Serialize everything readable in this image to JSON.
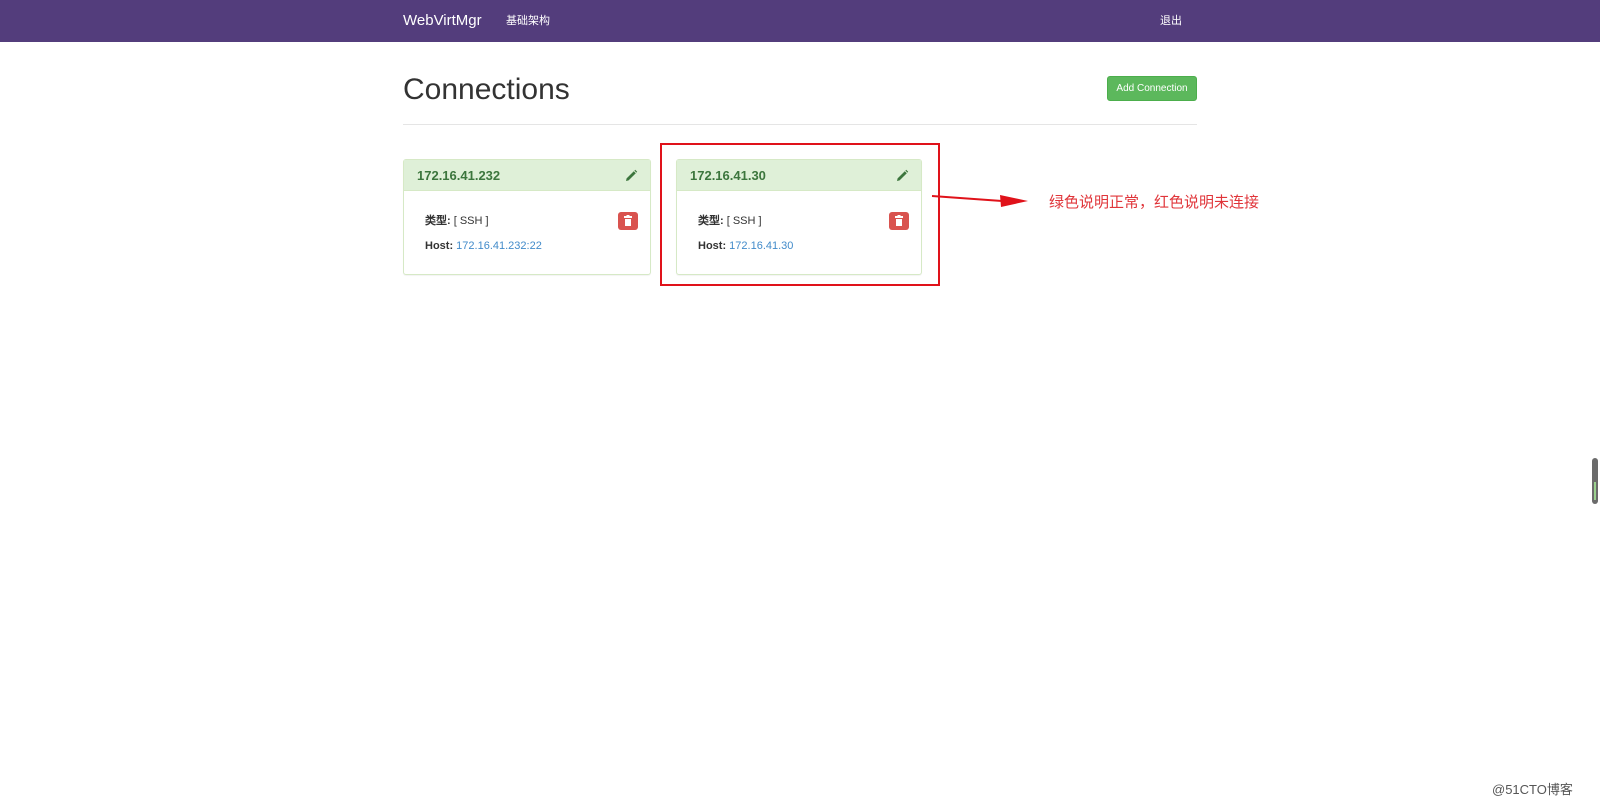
{
  "navbar": {
    "brand": "WebVirtMgr",
    "nav_link": "基础架构",
    "logout": "退出",
    "bg_color": "#533d7c"
  },
  "page": {
    "title": "Connections",
    "add_button_label": "Add Connection"
  },
  "connections": [
    {
      "title": "172.16.41.232",
      "type_label": "类型:",
      "type_value": "[ SSH ]",
      "host_label": "Host:",
      "host_value": "172.16.41.232:22",
      "status_color": "#dff0d8",
      "edit_icon": "pencil-icon",
      "delete_icon": "trash-icon"
    },
    {
      "title": "172.16.41.30",
      "type_label": "类型:",
      "type_value": "[ SSH ]",
      "host_label": "Host:",
      "host_value": "172.16.41.30",
      "status_color": "#dff0d8",
      "edit_icon": "pencil-icon",
      "delete_icon": "trash-icon"
    }
  ],
  "annotation": {
    "text": "绿色说明正常，红色说明未连接",
    "color": "#e0353a"
  },
  "watermark": "@51CTO博客"
}
